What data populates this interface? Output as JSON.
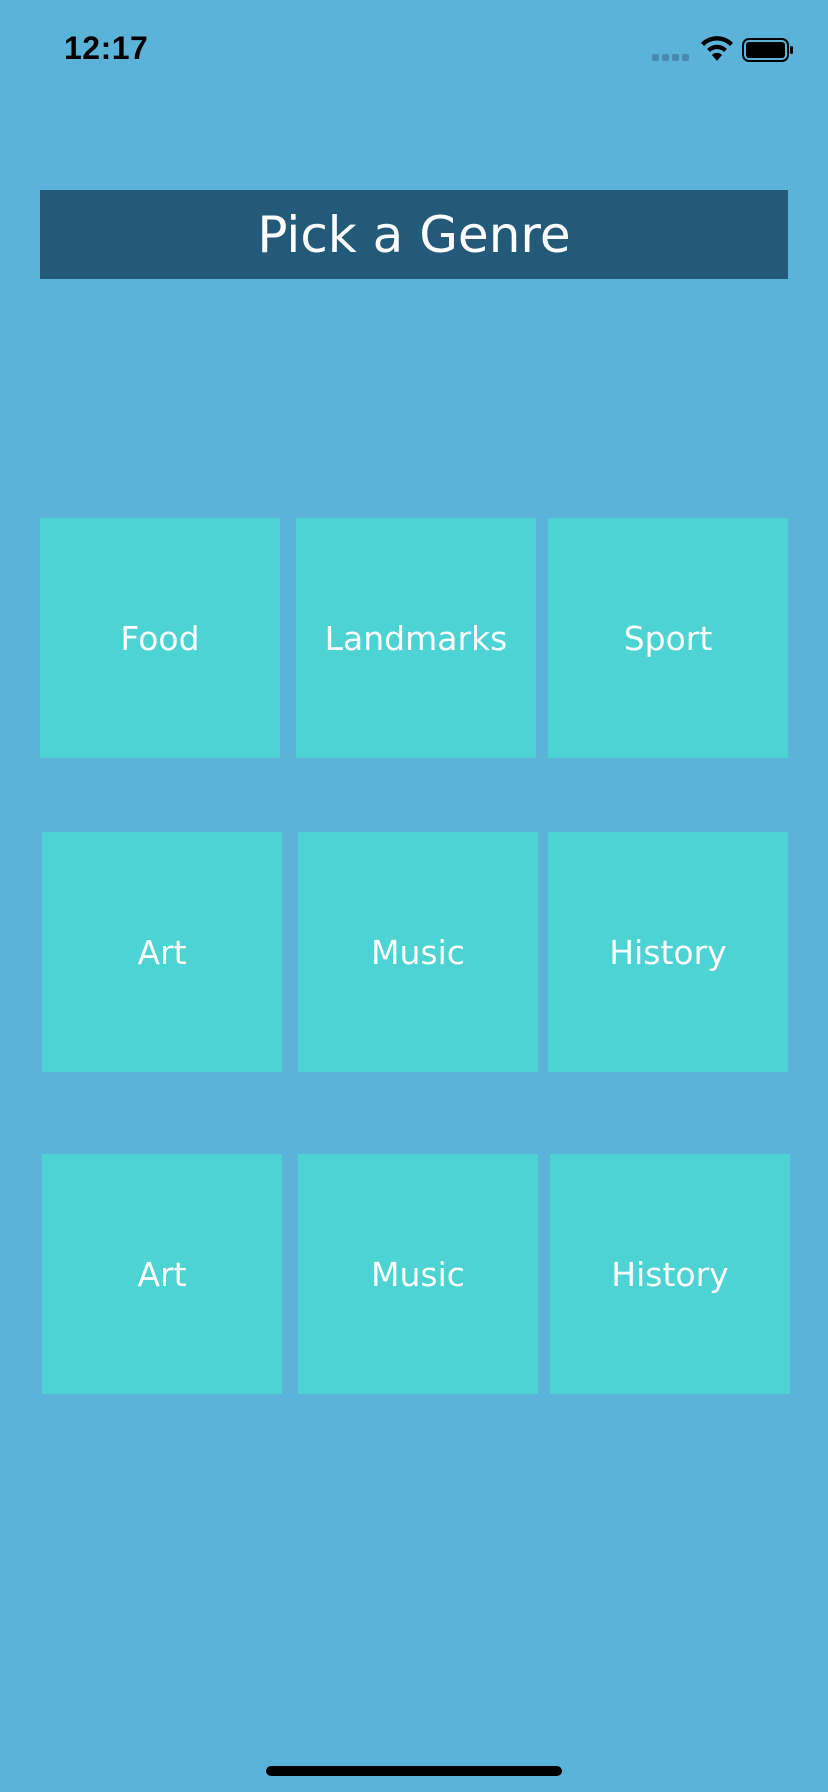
{
  "status_bar": {
    "time": "12:17",
    "icons": [
      "signal-dots-icon",
      "wifi-icon",
      "battery-icon"
    ]
  },
  "header": {
    "title": "Pick a Genre"
  },
  "genres": [
    "Food",
    "Landmarks",
    "Sport",
    "Art",
    "Music",
    "History",
    "Art",
    "Music",
    "History"
  ],
  "colors": {
    "background": "#5bb3da",
    "title_bar": "#235a7a",
    "tile": "#4dd3d3",
    "text": "#ffffff"
  }
}
